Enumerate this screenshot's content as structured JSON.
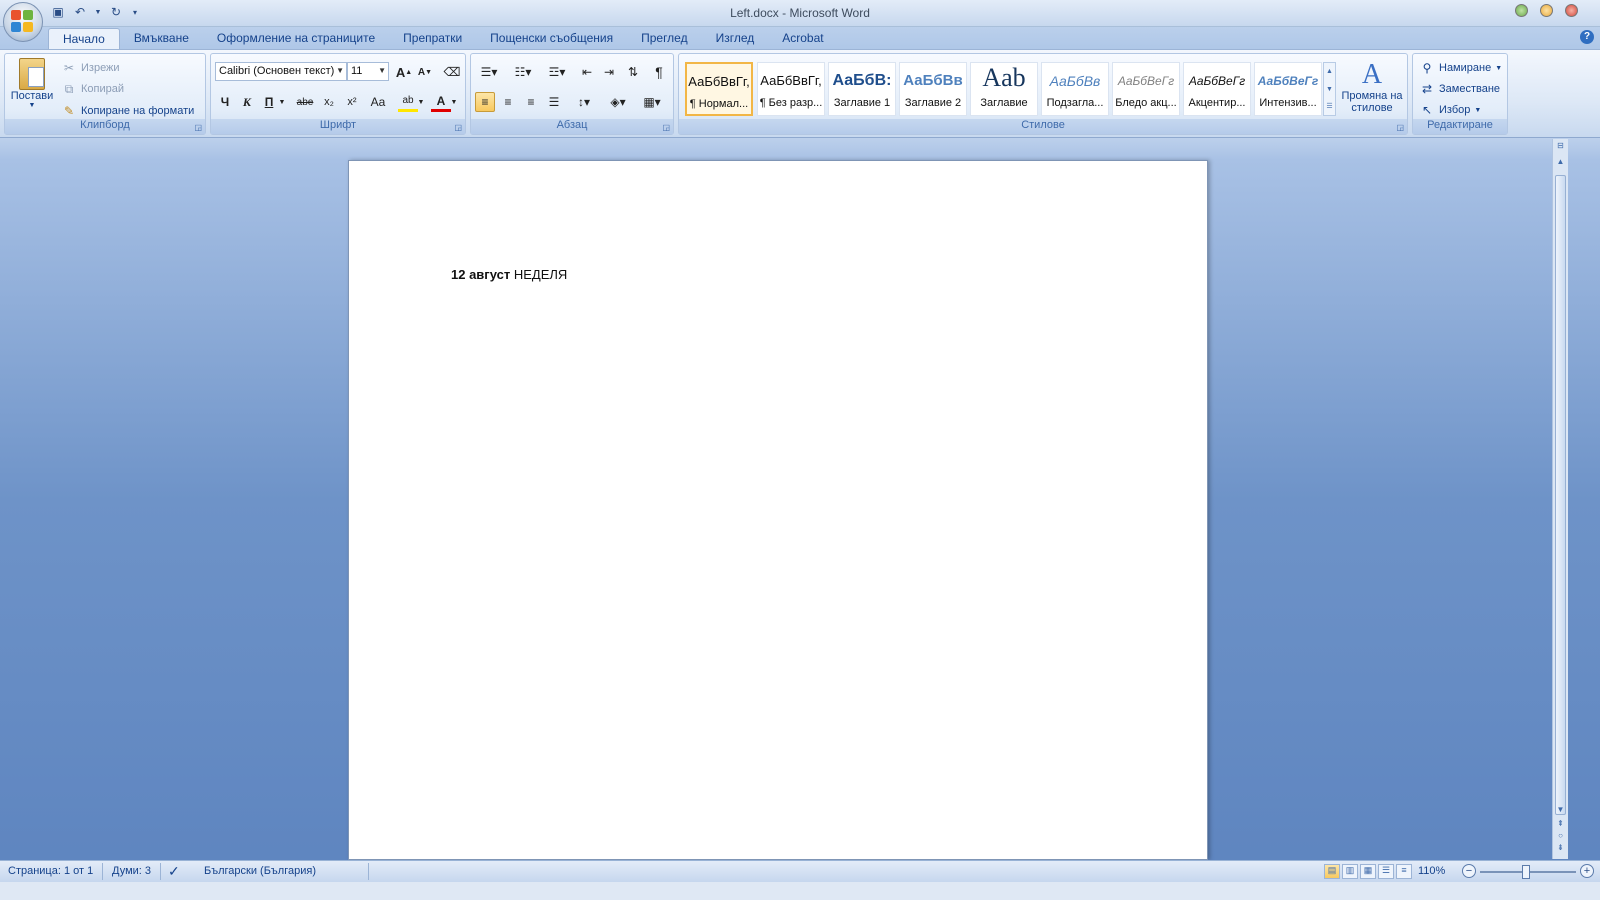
{
  "window": {
    "title": "Left.docx - Microsoft Word"
  },
  "tabs": [
    "Начало",
    "Вмъкване",
    "Оформление на страниците",
    "Препратки",
    "Пощенски съобщения",
    "Преглед",
    "Изглед",
    "Acrobat"
  ],
  "ribbon": {
    "clipboard": {
      "label": "Клипборд",
      "paste": "Постави",
      "cut": "Изрежи",
      "copy": "Копирай",
      "format_painter": "Копиране на формати"
    },
    "font": {
      "label": "Шрифт",
      "font_name": "Calibri (Основен текст)",
      "font_size": "11",
      "grow": "A",
      "shrink": "A",
      "bold": "Ч",
      "italic": "К",
      "underline": "П",
      "strike": "abe",
      "subscript": "x₂",
      "superscript": "x²",
      "case": "Aa",
      "highlight": "ab",
      "font_color": "A"
    },
    "paragraph": {
      "label": "Абзац",
      "pilcrow": "¶"
    },
    "styles": {
      "label": "Стилове",
      "items": [
        {
          "sample": "АаБбВвГг,",
          "name": "¶ Нормал..."
        },
        {
          "sample": "АаБбВвГг,",
          "name": "¶ Без разр..."
        },
        {
          "sample": "АаБбВ:",
          "name": "Заглавие 1"
        },
        {
          "sample": "АаБбВв",
          "name": "Заглавие 2"
        },
        {
          "sample": "Aab",
          "name": "Заглавие"
        },
        {
          "sample": "АаБбВв",
          "name": "Подзагла..."
        },
        {
          "sample": "АаБбВеГг",
          "name": "Бледо акц..."
        },
        {
          "sample": "АаБбВеГг",
          "name": "Акцентир..."
        },
        {
          "sample": "АаБбВеГг",
          "name": "Интензив..."
        }
      ],
      "change_styles": "Промяна на стилове"
    },
    "editing": {
      "label": "Редактиране",
      "find": "Намиране",
      "replace": "Заместване",
      "select": "Избор"
    }
  },
  "document": {
    "bold_text": "12 август",
    "normal_text": " НЕДЕЛЯ"
  },
  "status": {
    "page": "Страница: 1 от 1",
    "words": "Думи: 3",
    "language": "Български (България)",
    "zoom": "110%"
  }
}
